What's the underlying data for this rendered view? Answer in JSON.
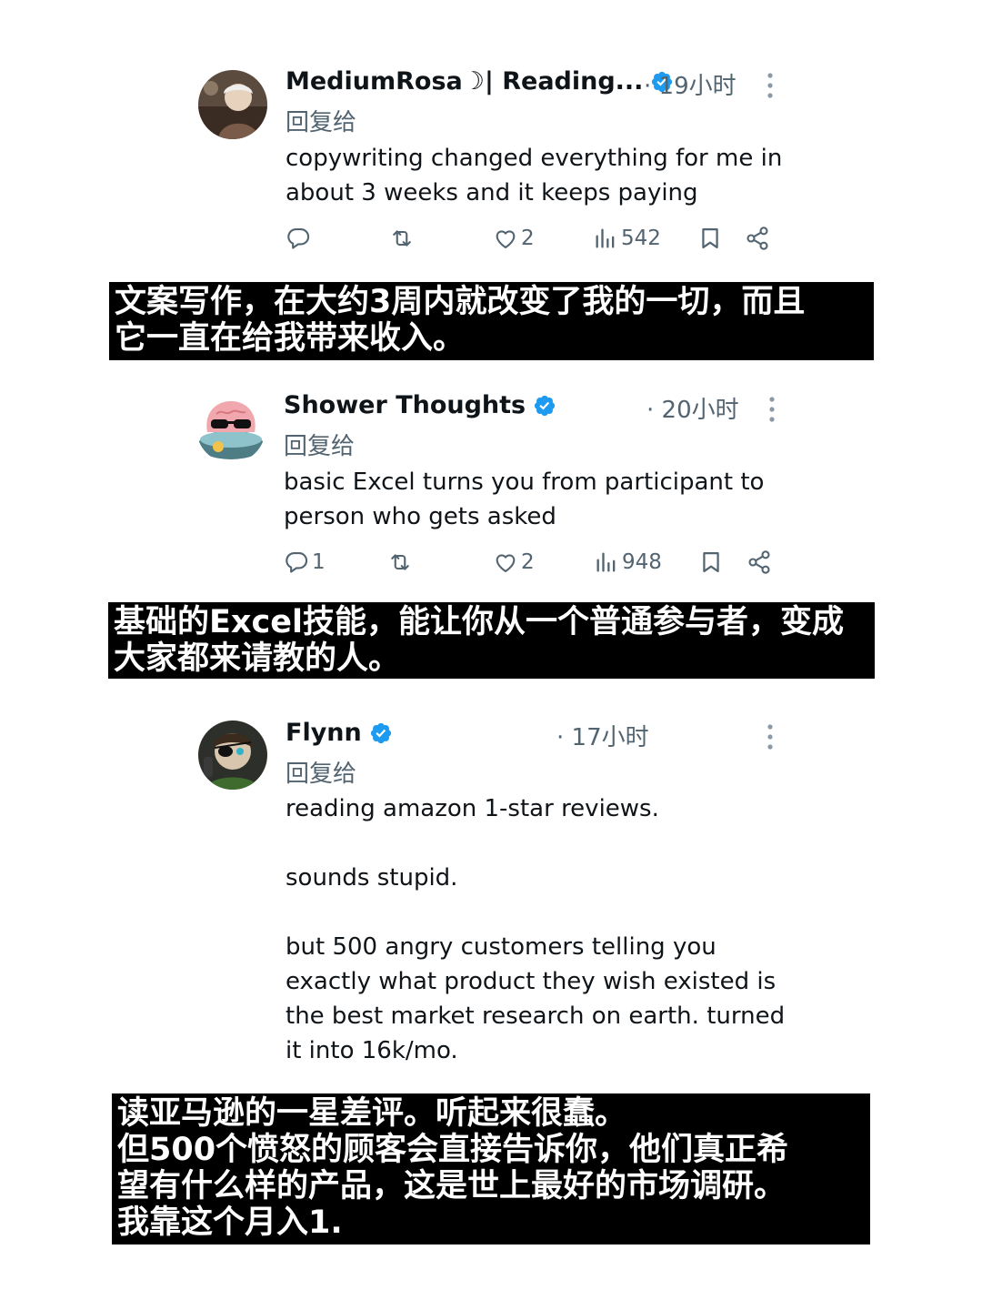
{
  "tweets": [
    {
      "name": "MediumRosa☽| Reading...",
      "time": "· 19小时",
      "reply_to": "回复给",
      "text": "copywriting changed everything for me in\nabout 3 weeks and it keeps paying",
      "replies": "",
      "likes": "2",
      "views": "542",
      "caption": "文案写作，在大约3周内就改变了我的一切，而且\n它一直在给我带来收入。"
    },
    {
      "name": "Shower Thoughts",
      "time": "· 20小时",
      "reply_to": "回复给",
      "text": "basic Excel turns you from participant to\nperson who gets asked",
      "replies": "1",
      "likes": "2",
      "views": "948",
      "caption": "基础的Excel技能，能让你从一个普通参与者，变成\n大家都来请教的人。"
    },
    {
      "name": "Flynn",
      "time": "· 17小时",
      "reply_to": "回复给",
      "text": "reading amazon 1-star reviews.\n\nsounds stupid.\n\nbut 500 angry customers telling you\nexactly what product they wish existed is\nthe best market research on earth. turned\nit into 16k/mo.",
      "caption": "读亚马逊的一星差评。听起来很蠢。\n但500个愤怒的顾客会直接告诉你，他们真正希\n望有什么样的产品，这是世上最好的市场调研。\n我靠这个月入1."
    }
  ],
  "colors": {
    "verified": "#1d9bf0",
    "secondary_text": "#536471",
    "caption_bg": "#000000",
    "caption_text": "#ffffff"
  },
  "icons": [
    "reply-icon",
    "retweet-icon",
    "like-icon",
    "views-icon",
    "bookmark-icon",
    "share-icon",
    "more-icon",
    "verified-badge-icon"
  ]
}
